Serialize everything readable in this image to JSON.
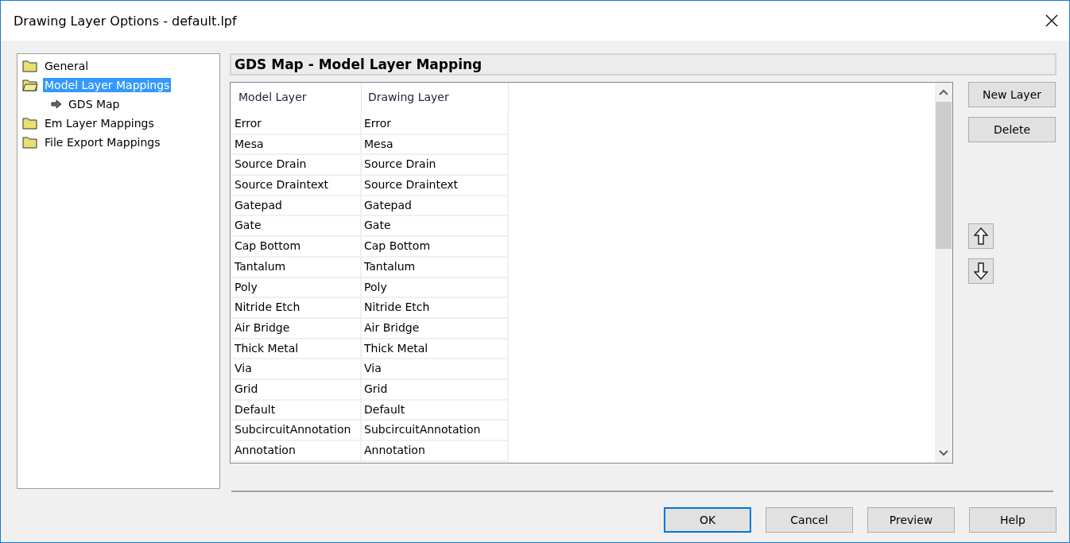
{
  "window": {
    "title": "Drawing Layer Options - default.lpf"
  },
  "tree": [
    {
      "label": "General",
      "selected": false,
      "expanded": false
    },
    {
      "label": "Model Layer Mappings",
      "selected": true,
      "expanded": true,
      "children": [
        {
          "label": "GDS Map",
          "selected": false
        }
      ]
    },
    {
      "label": "Em Layer Mappings",
      "selected": false,
      "expanded": false
    },
    {
      "label": "File Export Mappings",
      "selected": false,
      "expanded": false
    }
  ],
  "panel": {
    "title": "GDS Map - Model Layer Mapping"
  },
  "table": {
    "columns": [
      "Model Layer",
      "Drawing Layer"
    ],
    "rows": [
      [
        "Error",
        "Error"
      ],
      [
        "Mesa",
        "Mesa"
      ],
      [
        "Source Drain",
        "Source Drain"
      ],
      [
        "Source Draintext",
        "Source Draintext"
      ],
      [
        "Gatepad",
        "Gatepad"
      ],
      [
        "Gate",
        "Gate"
      ],
      [
        "Cap Bottom",
        "Cap Bottom"
      ],
      [
        "Tantalum",
        "Tantalum"
      ],
      [
        "Poly",
        "Poly"
      ],
      [
        "Nitride Etch",
        "Nitride Etch"
      ],
      [
        "Air Bridge",
        "Air Bridge"
      ],
      [
        "Thick Metal",
        "Thick Metal"
      ],
      [
        "Via",
        "Via"
      ],
      [
        "Grid",
        "Grid"
      ],
      [
        "Default",
        "Default"
      ],
      [
        "SubcircuitAnnotation",
        "SubcircuitAnnotation"
      ],
      [
        "Annotation",
        "Annotation"
      ]
    ]
  },
  "side_buttons": [
    "New Layer",
    "Delete"
  ],
  "footer_buttons": [
    {
      "label": "OK",
      "default": true
    },
    {
      "label": "Cancel",
      "default": false
    },
    {
      "label": "Preview",
      "default": false
    },
    {
      "label": "Help",
      "default": false
    }
  ]
}
